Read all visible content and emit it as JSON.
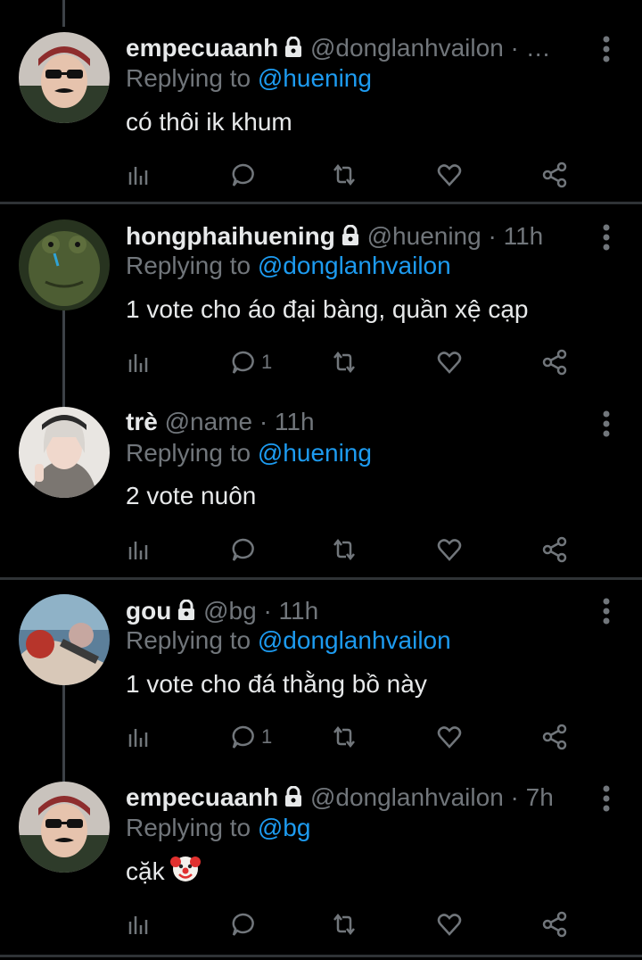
{
  "tweets": [
    {
      "name": "empecuaanh",
      "handle": "@donglanhvailon",
      "time": "· …",
      "reply_prefix": "Replying to ",
      "reply_to": "@huening",
      "text": "có thôi ik khum",
      "reply_count": "",
      "locked": true
    },
    {
      "name": "hongphaihuening",
      "handle": "@huening",
      "time": "· 11h",
      "reply_prefix": "Replying to ",
      "reply_to": "@donglanhvailon",
      "text": "1 vote cho áo đại bàng, quần xệ cạp",
      "reply_count": "1",
      "locked": true
    },
    {
      "name": "trè",
      "handle": "@name",
      "time": "· 11h",
      "reply_prefix": "Replying to ",
      "reply_to": "@huening",
      "text": "2 vote nuôn",
      "reply_count": "",
      "locked": false
    },
    {
      "name": "gou",
      "handle": "@bg",
      "time": "· 11h",
      "reply_prefix": "Replying to ",
      "reply_to": "@donglanhvailon",
      "text": "1 vote cho đá thằng bồ này",
      "reply_count": "1",
      "locked": true
    },
    {
      "name": "empecuaanh",
      "handle": "@donglanhvailon",
      "time": "· 7h",
      "reply_prefix": "Replying to ",
      "reply_to": "@bg",
      "text": "cặk",
      "reply_count": "",
      "locked": true,
      "emoji": "clown-face"
    }
  ],
  "colors": {
    "background": "#000000",
    "text": "#e7e9ea",
    "muted": "#71767b",
    "mention": "#1d9bf0",
    "divider": "#2f3336"
  }
}
